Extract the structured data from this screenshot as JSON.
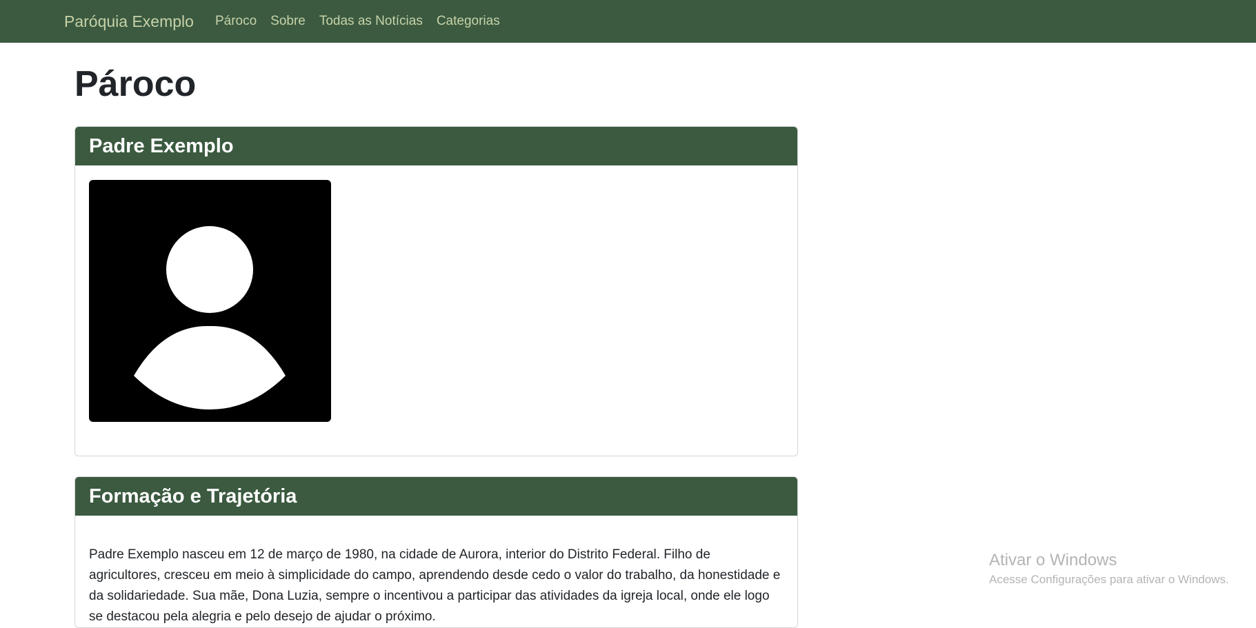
{
  "navbar": {
    "brand": "Paróquia Exemplo",
    "links": [
      "Pároco",
      "Sobre",
      "Todas as Notícias",
      "Categorias"
    ]
  },
  "page": {
    "title": "Pároco"
  },
  "priest_card": {
    "name": "Padre Exemplo",
    "avatar_icon": "user-silhouette-icon"
  },
  "bio_card": {
    "title": "Formação e Trajetória",
    "text": "Padre Exemplo nasceu em 12 de março de 1980, na cidade de Aurora, interior do Distrito Federal. Filho de agricultores, cresceu em meio à simplicidade do campo, aprendendo desde cedo o valor do trabalho, da honestidade e da solidariedade. Sua mãe, Dona Luzia, sempre o incentivou a participar das atividades da igreja local, onde ele logo se destacou pela alegria e pelo desejo de ajudar o próximo."
  },
  "watermark": {
    "title": "Ativar o Windows",
    "subtitle": "Acesse Configurações para ativar o Windows."
  },
  "colors": {
    "primary_green": "#3b5a40",
    "nav_text": "#c7d2a8"
  }
}
